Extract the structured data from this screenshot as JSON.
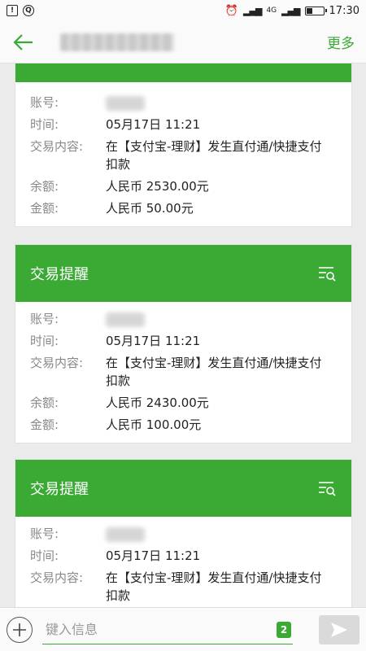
{
  "status": {
    "time": "17:30",
    "network": "4G"
  },
  "header": {
    "more_label": "更多"
  },
  "partial_card": {
    "rows": [
      {
        "label": "账号:",
        "value": ""
      },
      {
        "label": "时间:",
        "value": "05月17日 11:21"
      },
      {
        "label": "交易内容:",
        "value": "在【支付宝-理财】发生直付通/快捷支付扣款"
      },
      {
        "label": "余额:",
        "value": "人民币 2530.00元"
      },
      {
        "label": "金额:",
        "value": "人民币 50.00元"
      }
    ]
  },
  "cards": [
    {
      "title": "交易提醒",
      "rows": [
        {
          "label": "账号:",
          "value": ""
        },
        {
          "label": "时间:",
          "value": "05月17日 11:21"
        },
        {
          "label": "交易内容:",
          "value": "在【支付宝-理财】发生直付通/快捷支付扣款"
        },
        {
          "label": "余额:",
          "value": "人民币 2430.00元"
        },
        {
          "label": "金额:",
          "value": "人民币 100.00元"
        }
      ]
    },
    {
      "title": "交易提醒",
      "rows": [
        {
          "label": "账号:",
          "value": ""
        },
        {
          "label": "时间:",
          "value": "05月17日 11:21"
        },
        {
          "label": "交易内容:",
          "value": "在【支付宝-理财】发生直付通/快捷支付扣款"
        }
      ]
    }
  ],
  "input": {
    "placeholder": "键入信息",
    "badge": "2"
  },
  "colors": {
    "accent": "#3aaa35"
  },
  "icons": {
    "back": "arrow-left-icon",
    "tool": "filter-search-icon",
    "plus": "plus-icon",
    "send": "send-icon"
  }
}
